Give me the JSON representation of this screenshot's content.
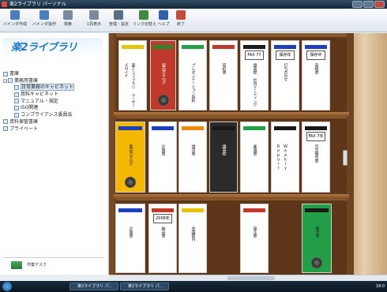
{
  "window": {
    "title": "楽2ライブラリ パーソナル"
  },
  "toolbar": {
    "items": [
      {
        "label": "バインダ作成",
        "icon": "binder-create-icon",
        "color": "#4a7fbf"
      },
      {
        "label": "バインダ操作",
        "icon": "binder-operate-icon",
        "color": "#4a7fbf"
      },
      {
        "label": "検索",
        "icon": "search-icon",
        "color": "#7a8a9a"
      },
      {
        "label": "1頁表示",
        "icon": "page-view-icon",
        "color": "#7a8a9a"
      },
      {
        "label": "管理・設定",
        "icon": "settings-icon",
        "color": "#5a6e82"
      },
      {
        "label": "リンク切替え",
        "icon": "link-switch-icon",
        "color": "#3f8a3f"
      },
      {
        "label": "ヘルプ",
        "icon": "help-icon",
        "color": "#2f5fa8"
      },
      {
        "label": "終了",
        "icon": "exit-icon",
        "color": "#c44a3a"
      }
    ]
  },
  "sidebar": {
    "logo": "楽2ライブラリ",
    "tree": [
      {
        "label": "書庫",
        "level": 0,
        "toggle": "",
        "selected": false
      },
      {
        "label": "業務用書庫",
        "level": 0,
        "toggle": "−",
        "selected": false
      },
      {
        "label": "日常業務のキャビネット",
        "level": 1,
        "toggle": "",
        "selected": true
      },
      {
        "label": "資料キャビネット",
        "level": 1,
        "toggle": "",
        "selected": false
      },
      {
        "label": "マニュアル・規定",
        "level": 1,
        "toggle": "",
        "selected": false
      },
      {
        "label": "ISO関連",
        "level": 1,
        "toggle": "",
        "selected": false
      },
      {
        "label": "コンプライアンス委員会",
        "level": 1,
        "toggle": "",
        "selected": false
      },
      {
        "label": "資料保管書庫",
        "level": 0,
        "toggle": "",
        "selected": false
      },
      {
        "label": "プライベート",
        "level": 0,
        "toggle": "",
        "selected": false
      }
    ],
    "desk_label": "作業デスク"
  },
  "binders": [
    {
      "title": "楽2ライブラリ ユーザーズガイド",
      "bar": "#e8c400",
      "label": "",
      "ring": false,
      "bg": "#fff"
    },
    {
      "title": "製品カタログ",
      "bar": "#2a8a2a",
      "label": "",
      "ring": true,
      "bg": "#c0392b"
    },
    {
      "title": "プレゼンテーション資料",
      "bar": "#23a047",
      "label": "",
      "ring": false,
      "bg": "#fff"
    },
    {
      "title": "契約書",
      "bar": "#c0392b",
      "label": "",
      "ring": false,
      "bg": "#fff"
    },
    {
      "title": "議事録 社内ミーティング",
      "bar": "#1a1a1a",
      "label": "FAX 77年",
      "ring": false,
      "bg": "#fff"
    },
    {
      "title": "打ち合わせ",
      "bar": "#1a3fbf",
      "label": "保存年",
      "ring": false,
      "bg": "#fff"
    },
    {
      "title": "見積書",
      "bar": "#1a3fbf",
      "label": "保存中",
      "ring": false,
      "bg": "#fff"
    },
    {
      "title": "製品カタログ",
      "bar": "#1a3fbf",
      "label": "",
      "ring": true,
      "bg": "#f5b800"
    },
    {
      "title": "企画書",
      "bar": "#1a3fbf",
      "label": "",
      "ring": false,
      "bg": "#fff"
    },
    {
      "title": "請求書",
      "bar": "#f08a00",
      "label": "",
      "ring": false,
      "bg": "#fff"
    },
    {
      "title": "議事録",
      "bar": "#1a1a1a",
      "label": "",
      "ring": false,
      "bg": "#2a2a2a"
    },
    {
      "title": "稟議書",
      "bar": "#23a047",
      "label": "",
      "ring": false,
      "bg": "#fff"
    },
    {
      "title": "Weekly Report",
      "bar": "#1a1a1a",
      "label": "",
      "ring": false,
      "bg": "#fff"
    },
    {
      "title": "月次報告書",
      "bar": "#1a1a1a",
      "label": "FAX 7年",
      "ring": false,
      "bg": "#fff"
    },
    {
      "title": "企画書",
      "bar": "#1a3fbf",
      "label": "",
      "ring": false,
      "bg": "#fff"
    },
    {
      "title": "納品書",
      "bar": "#c0392b",
      "label": "2008年",
      "ring": false,
      "bg": "#fff"
    },
    {
      "title": "会議案内",
      "bar": "#e8c400",
      "label": "",
      "ring": false,
      "bg": "#fff"
    },
    {
      "title": "発注書",
      "bar": "#c0392b",
      "label": "",
      "ring": false,
      "bg": "#fff"
    },
    {
      "title": "報告書",
      "bar": "#1a1a1a",
      "label": "",
      "ring": true,
      "bg": "#23a047"
    }
  ],
  "taskbar": {
    "tasks": [
      "楽2ライブラリ パ...",
      "楽2ライブラリ パ..."
    ],
    "clock": "18:0"
  }
}
